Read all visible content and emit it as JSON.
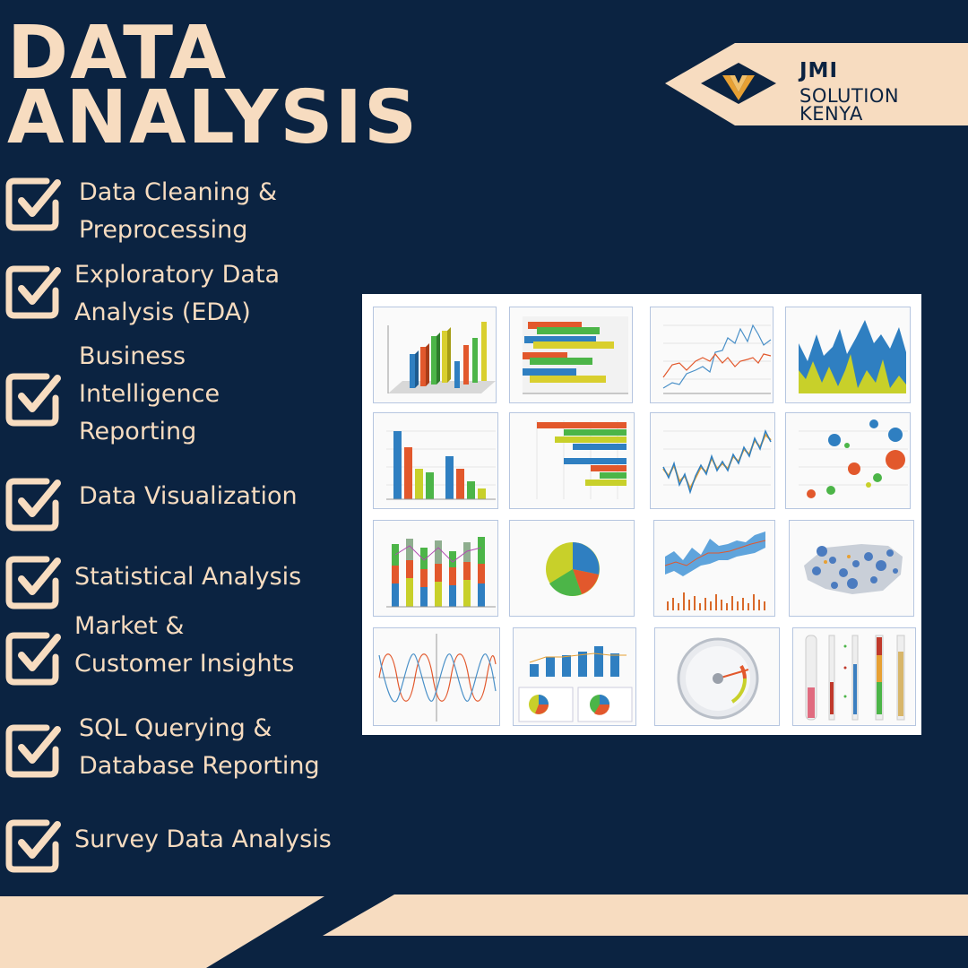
{
  "title": {
    "line1": "DATA",
    "line2": "ANALYSIS"
  },
  "brand": {
    "name": "JMI",
    "line1": "SOLUTION",
    "line2": "KENYA"
  },
  "services": [
    {
      "lines": [
        "Data Cleaning &",
        "Preprocessing"
      ]
    },
    {
      "lines": [
        "Exploratory Data",
        "Analysis (EDA)"
      ]
    },
    {
      "lines": [
        "Business",
        "Intelligence",
        "Reporting"
      ]
    },
    {
      "lines": [
        "Data Visualization"
      ]
    },
    {
      "lines": [
        "Statistical Analysis"
      ]
    },
    {
      "lines": [
        "Market &",
        "Customer Insights"
      ]
    },
    {
      "lines": [
        "SQL Querying &",
        "Database Reporting"
      ]
    },
    {
      "lines": [
        "Survey Data Analysis"
      ]
    }
  ],
  "colors": {
    "background": "#0b2341",
    "cream": "#f7dcc0",
    "logo_accent": "#e7a033"
  },
  "thumbnails": [
    "3d-column-chart",
    "3d-bar-chart",
    "line-chart",
    "area-chart",
    "column-chart",
    "bar-chart",
    "stock-line-chart",
    "bubble-chart",
    "stacked-column-chart",
    "pie-chart",
    "range-area-chart",
    "map-bubble-chart",
    "sine-wave-chart",
    "dashboard-chart",
    "gauge-chart",
    "thermometer-chart"
  ]
}
